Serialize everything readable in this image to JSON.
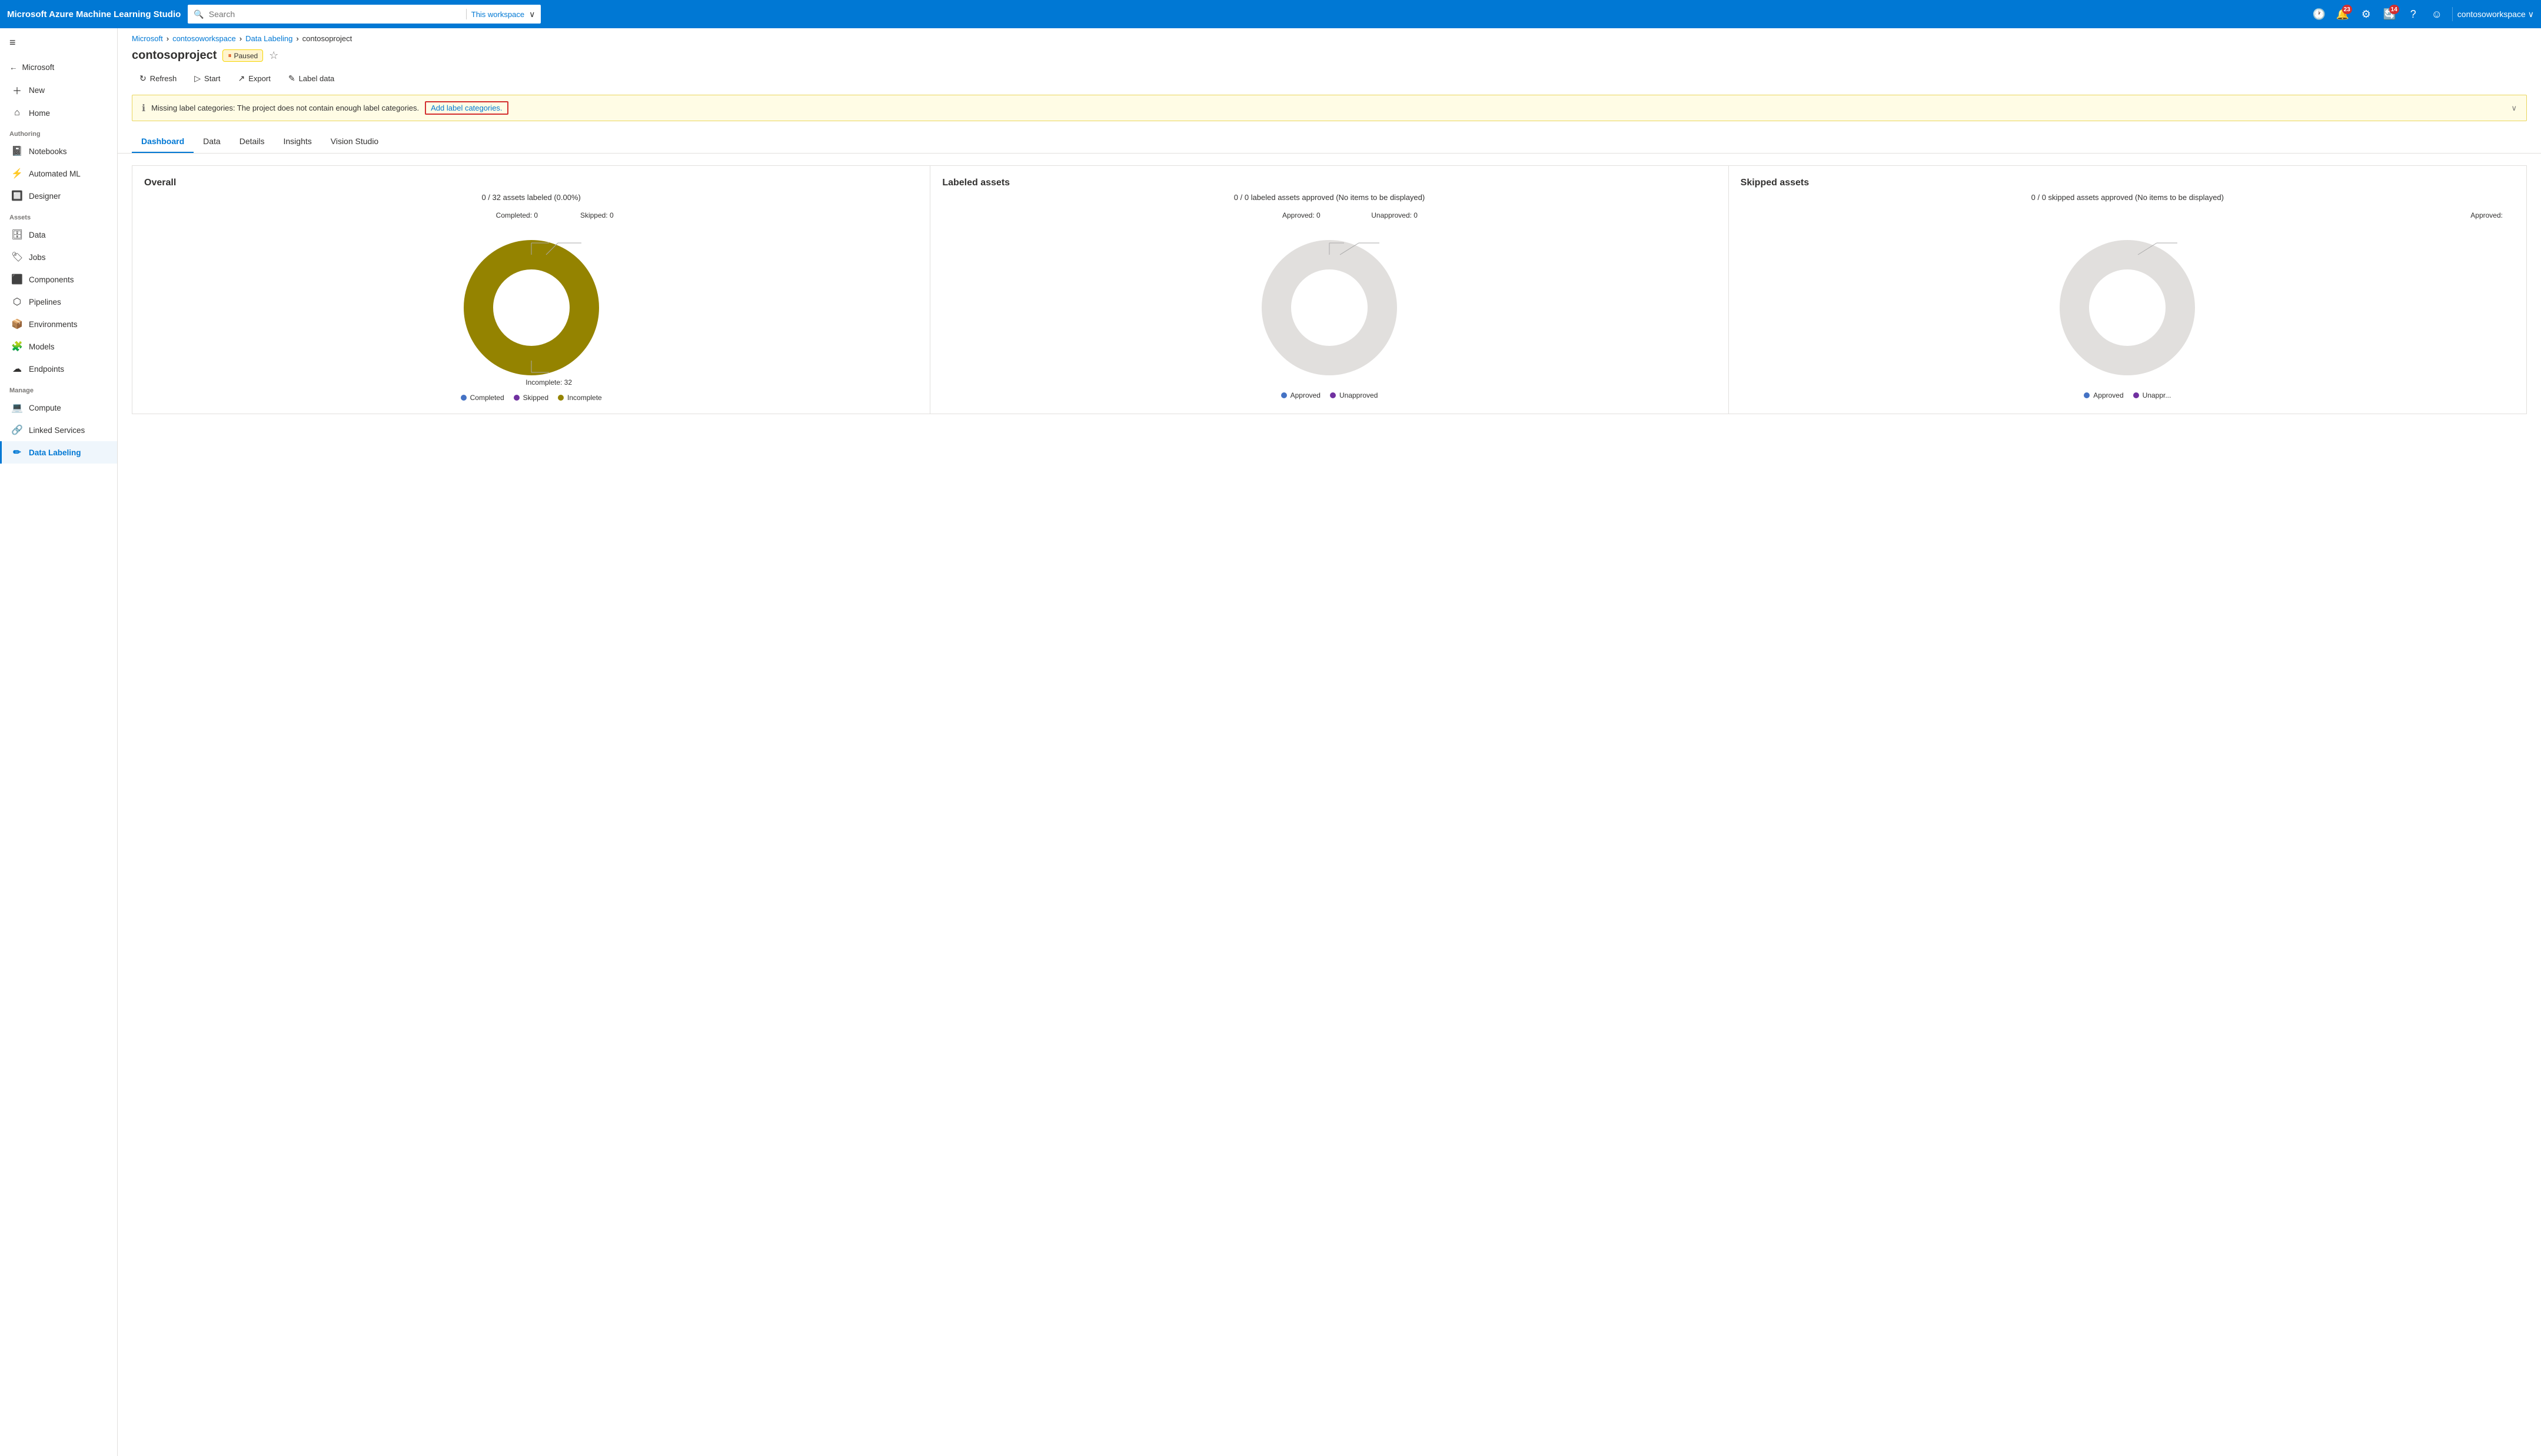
{
  "topbar": {
    "brand": "Microsoft Azure Machine Learning Studio",
    "search_placeholder": "Search",
    "search_scope": "This workspace",
    "workspace_name": "contosoworkspace",
    "notifications_count": "23",
    "settings_count": "14"
  },
  "sidebar": {
    "hamburger_label": "≡",
    "microsoft_label": "Microsoft",
    "nav_items": [
      {
        "id": "new",
        "label": "New",
        "icon": "＋"
      },
      {
        "id": "home",
        "label": "Home",
        "icon": "⌂"
      }
    ],
    "authoring_label": "Authoring",
    "authoring_items": [
      {
        "id": "notebooks",
        "label": "Notebooks",
        "icon": "📓"
      },
      {
        "id": "automated-ml",
        "label": "Automated ML",
        "icon": "⚡"
      },
      {
        "id": "designer",
        "label": "Designer",
        "icon": "🔲"
      }
    ],
    "assets_label": "Assets",
    "assets_items": [
      {
        "id": "data",
        "label": "Data",
        "icon": "🗄"
      },
      {
        "id": "jobs",
        "label": "Jobs",
        "icon": "🏷"
      },
      {
        "id": "components",
        "label": "Components",
        "icon": "⬛"
      },
      {
        "id": "pipelines",
        "label": "Pipelines",
        "icon": "⬡"
      },
      {
        "id": "environments",
        "label": "Environments",
        "icon": "📦"
      },
      {
        "id": "models",
        "label": "Models",
        "icon": "🧩"
      },
      {
        "id": "endpoints",
        "label": "Endpoints",
        "icon": "☁"
      }
    ],
    "manage_label": "Manage",
    "manage_items": [
      {
        "id": "compute",
        "label": "Compute",
        "icon": "💻"
      },
      {
        "id": "linked-services",
        "label": "Linked Services",
        "icon": "🔗"
      },
      {
        "id": "data-labeling",
        "label": "Data Labeling",
        "icon": "✏",
        "active": true
      }
    ]
  },
  "breadcrumb": {
    "items": [
      "Microsoft",
      "contosoworkspace",
      "Data Labeling"
    ],
    "current": "contosoproject"
  },
  "page": {
    "title": "contosoproject",
    "status": "Paused"
  },
  "toolbar": {
    "refresh_label": "Refresh",
    "start_label": "Start",
    "export_label": "Export",
    "label_data_label": "Label data"
  },
  "warning": {
    "message": "Missing label categories: The project does not contain enough label categories.",
    "link_label": "Add label categories."
  },
  "tabs": {
    "items": [
      "Dashboard",
      "Data",
      "Details",
      "Insights",
      "Vision Studio"
    ],
    "active": "Dashboard"
  },
  "overall_card": {
    "title": "Overall",
    "subtitle": "0 / 32 assets labeled (0.00%)",
    "completed_label": "Completed: 0",
    "skipped_label": "Skipped: 0",
    "incomplete_label": "Incomplete: 32",
    "legend": [
      {
        "label": "Completed",
        "color": "#4472c4"
      },
      {
        "label": "Skipped",
        "color": "#7030a0"
      },
      {
        "label": "Incomplete",
        "color": "#948300"
      }
    ],
    "donut": {
      "completed_pct": 0,
      "skipped_pct": 0,
      "incomplete_pct": 100,
      "colors": [
        "#4472c4",
        "#7030a0",
        "#948300"
      ]
    }
  },
  "labeled_card": {
    "title": "Labeled assets",
    "subtitle": "0 / 0 labeled assets approved (No items to be displayed)",
    "approved_label": "Approved: 0",
    "unapproved_label": "Unapproved: 0",
    "legend": [
      {
        "label": "Approved",
        "color": "#4472c4"
      },
      {
        "label": "Unapproved",
        "color": "#7030a0"
      }
    ]
  },
  "skipped_card": {
    "title": "Skipped assets",
    "subtitle": "0 / 0 skipped assets approved (No items to be displayed)",
    "approved_label": "Approved:",
    "legend": [
      {
        "label": "Approved",
        "color": "#4472c4"
      },
      {
        "label": "Unappr...",
        "color": "#7030a0"
      }
    ]
  },
  "icons": {
    "hamburger": "≡",
    "search": "🔍",
    "clock": "🕐",
    "bell": "🔔",
    "gear": "⚙",
    "updates": "🔄",
    "help": "?",
    "smiley": "☺",
    "chevron_down": "∨",
    "chevron_right": ">",
    "info": "ℹ",
    "pause": "⏸",
    "star": "☆",
    "refresh": "↻",
    "play": "▷",
    "export": "↗",
    "label": "✎",
    "collapse": "∨"
  }
}
